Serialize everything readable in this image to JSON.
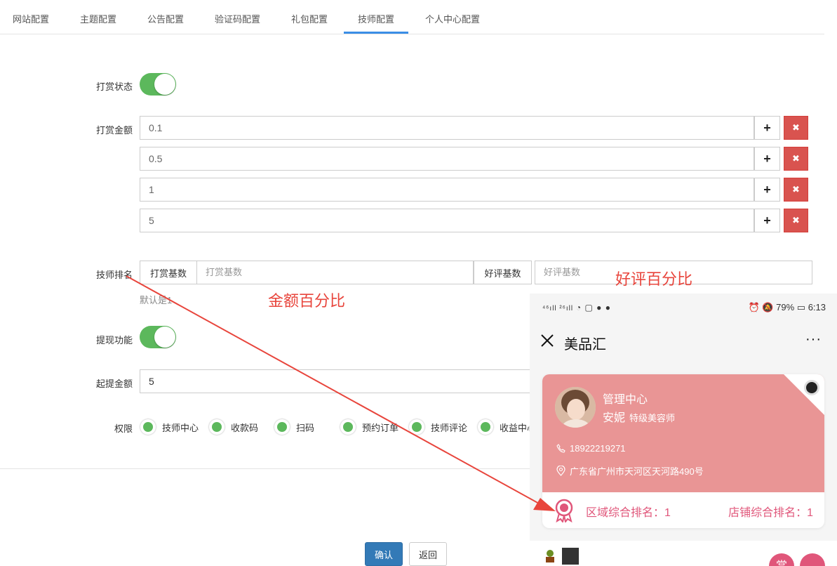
{
  "tabs": [
    {
      "label": "网站配置"
    },
    {
      "label": "主题配置"
    },
    {
      "label": "公告配置"
    },
    {
      "label": "验证码配置"
    },
    {
      "label": "礼包配置"
    },
    {
      "label": "技师配置"
    },
    {
      "label": "个人中心配置"
    }
  ],
  "active_tab": "技师配置",
  "form": {
    "reward_status_label": "打赏状态",
    "reward_status_on": true,
    "reward_amount_label": "打赏金额",
    "amounts": [
      "0.1",
      "0.5",
      "1",
      "5"
    ],
    "plus_icon": "plus-icon",
    "delete_icon": "times-icon",
    "ranking_label": "技师排名",
    "reward_base_addon": "打赏基数",
    "reward_base_placeholder": "打赏基数",
    "review_base_addon": "好评基数",
    "review_base_placeholder": "好评基数",
    "ranking_help": "默认是1",
    "withdraw_label": "提现功能",
    "withdraw_on": true,
    "min_withdraw_label": "起提金额",
    "min_withdraw_value": "5",
    "perm_label": "权限",
    "permissions": [
      "技师中心",
      "收款码",
      "扫码",
      "预约订单",
      "技师评论",
      "收益中心"
    ],
    "confirm_label": "确认",
    "back_label": "返回"
  },
  "annotations": {
    "amount_percent": "金额百分比",
    "review_percent": "好评百分比"
  },
  "phone": {
    "status_left": "⁴⁶ıll ²⁶ıll",
    "battery": "79%",
    "time": "6:13",
    "app_title": "美品汇",
    "more": "···",
    "card": {
      "title": "管理中心",
      "name": "安妮",
      "role": "特级美容师",
      "phone": "18922219271",
      "address": "广东省广州市天河区天河路490号",
      "region_rank": "区域综合排名：1",
      "store_rank": "店铺综合排名：1"
    },
    "fab_reward": "赏"
  },
  "colors": {
    "accent": "#3a8ee6",
    "toggle_on": "#5cb85c",
    "danger": "#d9534f",
    "primary": "#337ab7",
    "card_pink": "#e99595",
    "rank_pink": "#e0567a",
    "annotation_red": "#e8453c"
  }
}
